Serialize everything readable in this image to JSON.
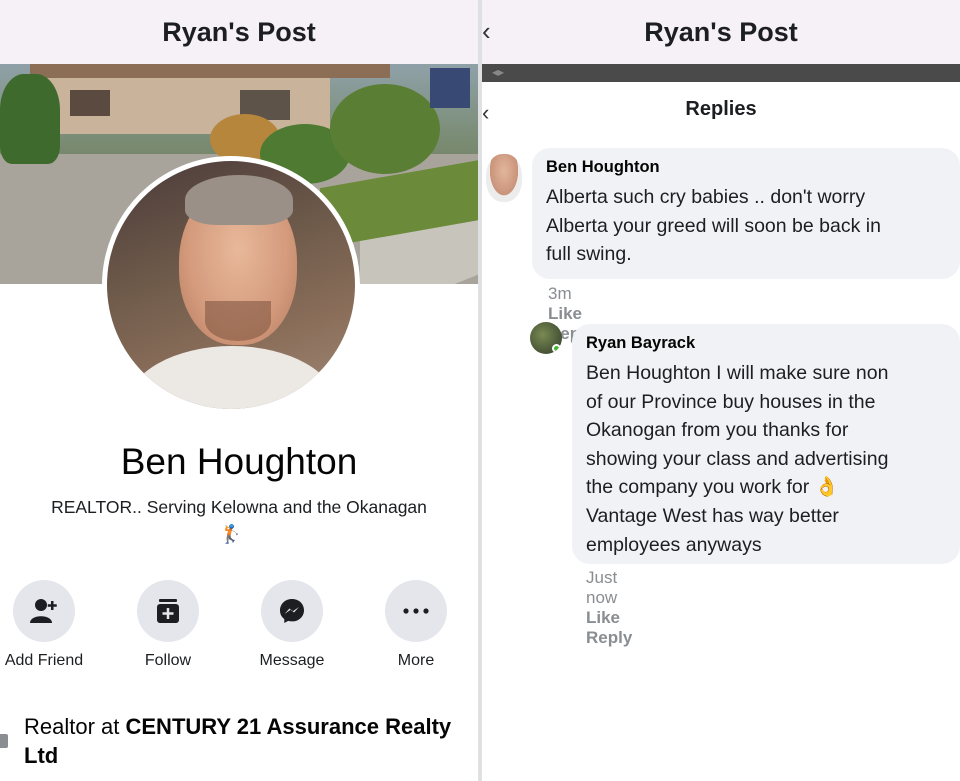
{
  "left_panel": {
    "header_title": "Ryan's Post",
    "profile": {
      "name": "Ben Houghton",
      "bio": "REALTOR.. Serving Kelowna and the Okanagan",
      "bio_emoji": "🏌"
    },
    "actions": [
      {
        "label": "Add Friend",
        "icon": "add-friend-icon"
      },
      {
        "label": "Follow",
        "icon": "follow-icon"
      },
      {
        "label": "Message",
        "icon": "messenger-icon"
      },
      {
        "label": "More",
        "icon": "more-icon"
      }
    ],
    "work": {
      "prefix": "Realtor at ",
      "company": "CENTURY 21 Assurance Realty Ltd"
    }
  },
  "right_panel": {
    "header_title": "Ryan's Post",
    "replies_title": "Replies",
    "comments": [
      {
        "author": "Ben Houghton",
        "body": "Alberta such cry babies .. don't worry\nAlberta your greed will soon be back in\nfull swing.",
        "time": "3m",
        "like": "Like",
        "reply": "Reply"
      },
      {
        "author": "Ryan Bayrack",
        "body": "Ben Houghton I will make sure non\nof our Province buy houses in the\nOkanogan from you thanks for\nshowing your class and advertising\nthe company you work for 👌\nVantage West has way better\nemployees anyways",
        "time": "Just now",
        "like": "Like",
        "reply": "Reply"
      }
    ]
  },
  "colors": {
    "header_bg": "#f5f1f7",
    "bubble_bg": "#f0f2f5",
    "action_circle": "#e4e6eb",
    "meta_gray": "#8a8d91",
    "online_green": "#42b72a"
  }
}
